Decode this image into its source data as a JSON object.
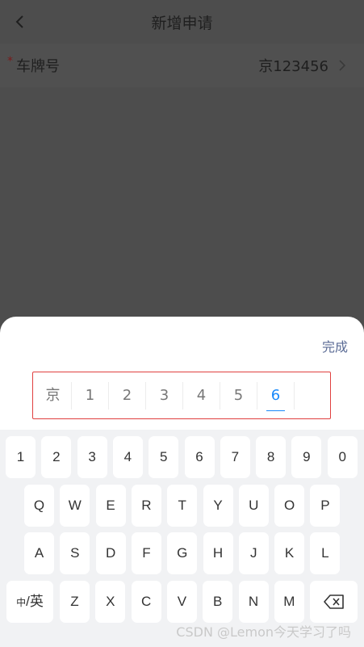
{
  "nav": {
    "title": "新增申请"
  },
  "form": {
    "required_mark": "*",
    "label": "车牌号",
    "value": "京123456"
  },
  "sheet": {
    "done_label": "完成"
  },
  "plate": {
    "chars": [
      "京",
      "1",
      "2",
      "3",
      "4",
      "5",
      "6",
      ""
    ],
    "active_index": 6
  },
  "keyboard": {
    "row1": [
      "1",
      "2",
      "3",
      "4",
      "5",
      "6",
      "7",
      "8",
      "9",
      "0"
    ],
    "row2": [
      "Q",
      "W",
      "E",
      "R",
      "T",
      "Y",
      "U",
      "O",
      "P"
    ],
    "row3": [
      "A",
      "S",
      "D",
      "F",
      "G",
      "H",
      "J",
      "K",
      "L"
    ],
    "row4": [
      "Z",
      "X",
      "C",
      "V",
      "B",
      "N",
      "M"
    ],
    "switch_small": "中",
    "switch_main": "/英",
    "backspace_icon": "backspace-icon"
  },
  "watermark": "CSDN @Lemon今天学习了吗",
  "colors": {
    "accent": "#1989fa",
    "plate_border": "#e0403f",
    "done": "#5b6b95"
  }
}
